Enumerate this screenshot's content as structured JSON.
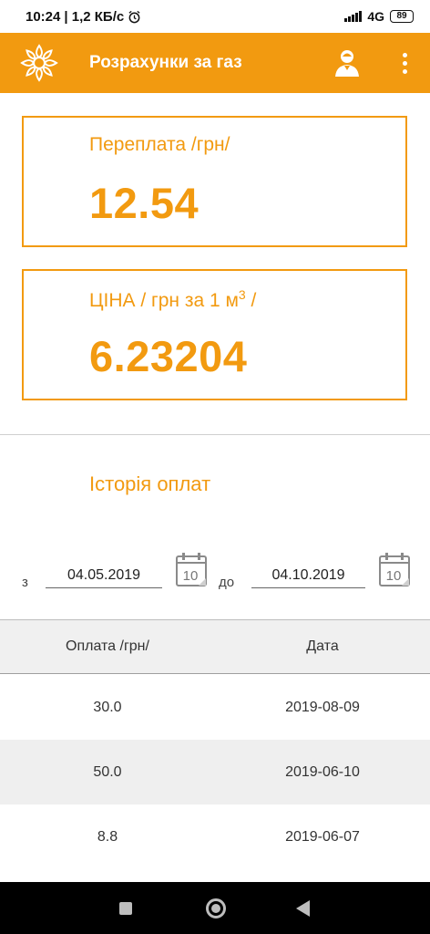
{
  "status_bar": {
    "time": "10:24",
    "speed": "| 1,2 КБ/с",
    "network": "4G",
    "battery": "89"
  },
  "app_bar": {
    "title": "Розрахунки за газ",
    "brand_color": "#f29a10"
  },
  "overpayment": {
    "label": "Переплата /грн/",
    "value": "12.54"
  },
  "price": {
    "label": "ЦІНА / грн за 1 м",
    "label_sup": "3",
    "label_suffix": " /",
    "value": "6.23204"
  },
  "history": {
    "title": "Історія оплат",
    "from_label": "з",
    "from_date": "04.05.2019",
    "to_label": "до",
    "to_date": "04.10.2019",
    "calendar_day": "10",
    "columns": [
      "Оплата /грн/",
      "Дата"
    ],
    "rows": [
      {
        "amount": "30.0",
        "date": "2019-08-09"
      },
      {
        "amount": "50.0",
        "date": "2019-06-10"
      },
      {
        "amount": "8.8",
        "date": "2019-06-07"
      }
    ]
  },
  "icons": {
    "logo": "sun-flower-logo-icon",
    "user": "user-icon",
    "menu": "more-vert-icon",
    "calendar": "calendar-icon"
  }
}
